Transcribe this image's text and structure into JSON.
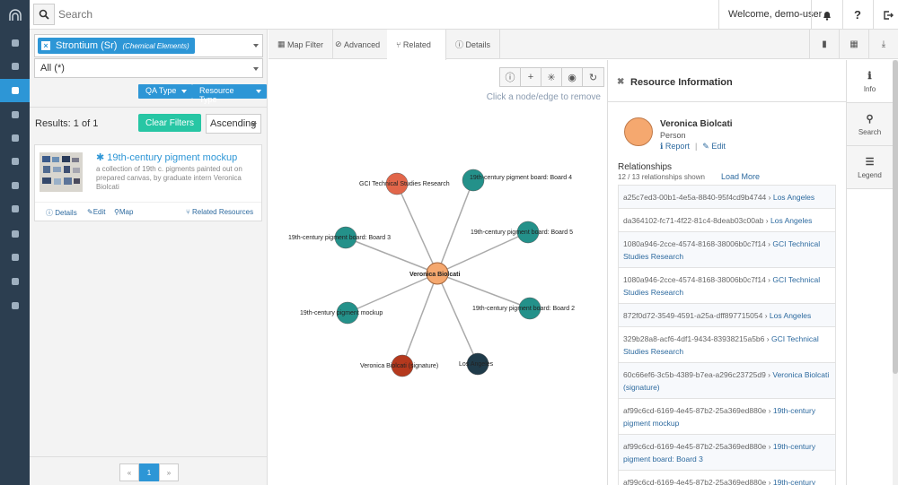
{
  "topbar": {
    "search_placeholder": "Search",
    "welcome": "Welcome, demo-user",
    "help_icon": "?"
  },
  "left": {
    "tag_label": "Strontium (Sr)",
    "tag_sub": "(Chemical Elements)",
    "select_value": "All (*)",
    "qa_type": "QA Type",
    "resource_type": "Resource Type",
    "results": "Results: 1 of 1",
    "clear_filters": "Clear Filters",
    "sort": "Ascending",
    "card": {
      "title": "19th-century pigment mockup",
      "description": "a collection of 19th c. pigments painted out on prepared canvas, by graduate intern Veronica Biolcati",
      "details": "Details",
      "edit": "Edit",
      "map": "Map",
      "related": "Related Resources"
    },
    "pager": {
      "prev": "«",
      "page": "1",
      "next": "»"
    }
  },
  "tabs": {
    "map_filter": "Map Filter",
    "advanced": "Advanced",
    "related": "Related",
    "details": "Details"
  },
  "graph": {
    "hint": "Click a node/edge to remove",
    "center": {
      "label": "Veronica Biolcati",
      "color": "#f5a86f"
    },
    "nodes": [
      {
        "label": "GCI Technical Studies Research",
        "color": "#e2664a"
      },
      {
        "label": "19th-century pigment board: Board 4",
        "color": "#24918a"
      },
      {
        "label": "19th-century pigment board: Board 3",
        "color": "#24918a"
      },
      {
        "label": "19th-century pigment board: Board 5",
        "color": "#24918a"
      },
      {
        "label": "19th-century pigment mockup",
        "color": "#24918a"
      },
      {
        "label": "19th-century pigment board: Board 2",
        "color": "#24918a"
      },
      {
        "label": "Veronica Biolcati (signature)",
        "color": "#b5391e"
      },
      {
        "label": "Los Angeles",
        "color": "#1f3b4a"
      }
    ]
  },
  "info": {
    "title": "Resource Information",
    "name": "Veronica Biolcati",
    "type": "Person",
    "report": "Report",
    "sep": "|",
    "edit": "Edit",
    "relationships_title": "Relationships",
    "relationships_count": "12 / 13 relationships shown",
    "load_more": "Load More",
    "relationships": [
      {
        "id": "a25c7ed3-00b1-4e5a-8840-95f4cd9b4744",
        "target": "Los Angeles"
      },
      {
        "id": "da364102-fc71-4f22-81c4-8deab03c00ab",
        "target": "Los Angeles"
      },
      {
        "id": "1080a946-2cce-4574-8168-38006b0c7f14",
        "target": "GCI Technical Studies Research"
      },
      {
        "id": "1080a946-2cce-4574-8168-38006b0c7f14",
        "target": "GCI Technical Studies Research"
      },
      {
        "id": "872f0d72-3549-4591-a25a-dff897715054",
        "target": "Los Angeles"
      },
      {
        "id": "329b28a8-acf6-4df1-9434-83938215a5b6",
        "target": "GCI Technical Studies Research"
      },
      {
        "id": "60c66ef6-3c5b-4389-b7ea-a296c23725d9",
        "target": "Veronica Biolcati (signature)"
      },
      {
        "id": "af99c6cd-6169-4e45-87b2-25a369ed880e",
        "target": "19th-century pigment mockup"
      },
      {
        "id": "af99c6cd-6169-4e45-87b2-25a369ed880e",
        "target": "19th-century pigment board: Board 3"
      },
      {
        "id": "af99c6cd-6169-4e45-87b2-25a369ed880e",
        "target": "19th-century"
      }
    ]
  },
  "sidenav": {
    "info": "Info",
    "search": "Search",
    "legend": "Legend"
  },
  "colors": {
    "accent": "#2d96d6",
    "rail": "#2c3e50",
    "clear_button": "#27c6a4"
  }
}
